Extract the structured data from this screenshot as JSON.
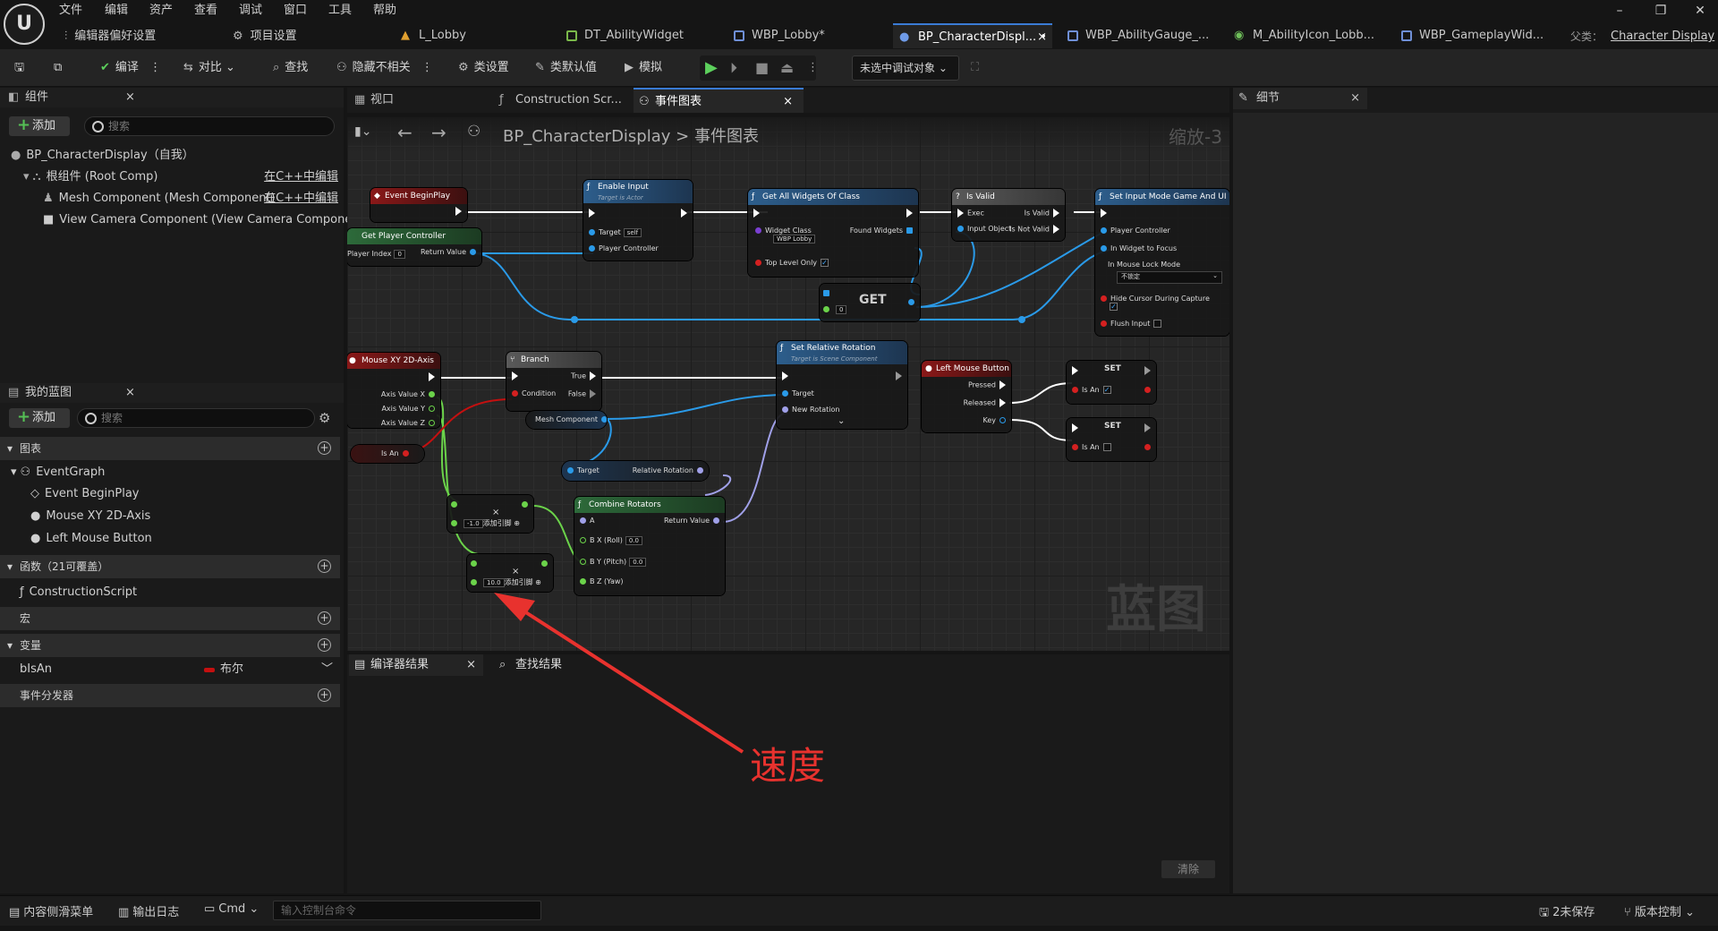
{
  "menu": [
    "文件",
    "编辑",
    "资产",
    "查看",
    "调试",
    "窗口",
    "工具",
    "帮助"
  ],
  "subbar": {
    "editor_prefs": "编辑器偏好设置",
    "project_settings": "项目设置"
  },
  "tabs": [
    {
      "label": "L_Lobby"
    },
    {
      "label": "DT_AbilityWidget"
    },
    {
      "label": "WBP_Lobby*"
    },
    {
      "label": "BP_CharacterDispl... •"
    },
    {
      "label": "WBP_AbilityGauge_..."
    },
    {
      "label": "M_AbilityIcon_Lobb..."
    },
    {
      "label": "WBP_GameplayWid..."
    }
  ],
  "parent_class": {
    "label": "父类：",
    "value": "Character Display"
  },
  "toolbar": {
    "compile": "编译",
    "diff": "对比",
    "find": "查找",
    "hide_unrelated": "隐藏不相关",
    "class_settings": "类设置",
    "class_defaults": "类默认值",
    "simulate": "模拟",
    "debug_target": "未选中调试对象"
  },
  "components_panel": {
    "title": "组件",
    "add": "添加",
    "search_placeholder": "搜索",
    "items": [
      {
        "label": "BP_CharacterDisplay（自我）",
        "edit": ""
      },
      {
        "label": "根组件 (Root Comp)",
        "edit": "在C++中编辑"
      },
      {
        "label": "Mesh Component (Mesh Component)",
        "edit": "在C++中编辑"
      },
      {
        "label": "View Camera Component (View Camera Component)",
        "edit": ""
      }
    ]
  },
  "editor_tabs": {
    "viewport": "视口",
    "construction": "Construction Scr...",
    "event_graph": "事件图表"
  },
  "graph": {
    "breadcrumb_root": "BP_CharacterDisplay",
    "breadcrumb_sep": ">",
    "breadcrumb_current": "事件图表",
    "zoom": "缩放-3",
    "watermark": "蓝图",
    "annotation": "速度",
    "nodes": {
      "begin_play": "Event BeginPlay",
      "enable_input": {
        "title": "Enable Input",
        "sub": "Target is Actor",
        "target": "Target",
        "self": "self",
        "pc": "Player Controller"
      },
      "get_pc": {
        "title": "Get Player Controller",
        "player_index": "Player Index",
        "player_index_val": "0",
        "return": "Return Value"
      },
      "get_all_widgets": {
        "title": "Get All Widgets Of Class",
        "widget_class": "Widget Class",
        "class_val": "WBP Lobby",
        "found": "Found Widgets",
        "top_level": "Top Level Only"
      },
      "get": {
        "title": "GET",
        "index": "0"
      },
      "is_valid": {
        "title": "Is Valid",
        "exec": "Exec",
        "is_valid": "Is Valid",
        "input": "Input Object",
        "not_valid": "Is Not Valid"
      },
      "set_input_mode": {
        "title": "Set Input Mode Game And UI",
        "pc": "Player Controller",
        "widget": "In Widget to Focus",
        "lock": "In Mouse Lock Mode",
        "lock_val": "不锁定",
        "hide": "Hide Cursor During Capture",
        "flush": "Flush Input"
      },
      "mouse_xy": {
        "title": "Mouse XY 2D-Axis",
        "x": "Axis Value X",
        "y": "Axis Value Y",
        "z": "Axis Value Z"
      },
      "is_an": "Is An",
      "branch": {
        "title": "Branch",
        "true": "True",
        "false": "False",
        "cond": "Condition"
      },
      "mesh_comp": "Mesh Component",
      "set_rel_rot": {
        "title": "Set Relative Rotation",
        "sub": "Target is Scene Component",
        "target": "Target",
        "new_rot": "New Rotation"
      },
      "get_rel_rot": {
        "target": "Target",
        "rel": "Relative Rotation"
      },
      "combine": {
        "title": "Combine Rotators",
        "a": "A",
        "x": "B X (Roll)",
        "y": "B Y (Pitch)",
        "z": "B Z (Yaw)",
        "ret": "Return Value",
        "xval": "0.0",
        "yval": "0.0"
      },
      "mul1": {
        "val": "-1.0",
        "add": "添加引脚"
      },
      "mul2": {
        "val": "10.0",
        "add": "添加引脚"
      },
      "lmb": {
        "title": "Left Mouse Button",
        "pressed": "Pressed",
        "released": "Released",
        "key": "Key"
      },
      "set1": {
        "title": "SET",
        "isan": "Is An"
      },
      "set2": {
        "title": "SET",
        "isan": "Is An"
      }
    }
  },
  "my_blueprint": {
    "title": "我的蓝图",
    "add": "添加",
    "search_placeholder": "搜索",
    "graphs_label": "图表",
    "event_graph": "EventGraph",
    "events": [
      "Event BeginPlay",
      "Mouse XY 2D-Axis",
      "Left Mouse Button"
    ],
    "functions_label": "函数（21可覆盖）",
    "construction": "ConstructionScript",
    "macros_label": "宏",
    "variables_label": "变量",
    "var": {
      "name": "bIsAn",
      "type": "布尔"
    },
    "dispatchers_label": "事件分发器"
  },
  "details": {
    "title": "细节"
  },
  "bottom": {
    "compiler_results": "编译器结果",
    "find_results": "查找结果",
    "clear": "清除"
  },
  "status": {
    "drawer": "内容侧滑菜单",
    "log": "输出日志",
    "cmd": "Cmd",
    "console_placeholder": "输入控制台命令",
    "unsaved": "2未保存",
    "source_control": "版本控制"
  }
}
